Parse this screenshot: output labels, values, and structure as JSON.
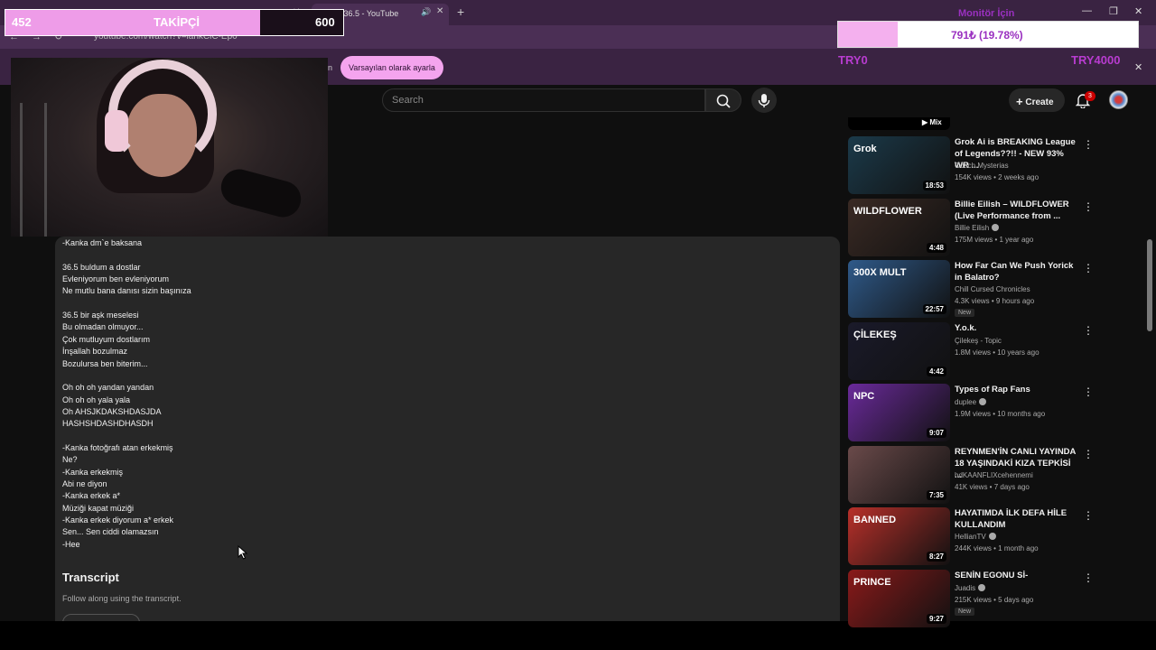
{
  "browser": {
    "prev_tab_partial": "akti 15 -",
    "active_tab_title": "(3) 36.5 - YouTube",
    "url": "youtube.com/watch?v=lahkClC-Ep0",
    "infobar_partial": "n",
    "default_button": "Varsayılan olarak ayarla"
  },
  "overlay": {
    "follower": {
      "current": "452",
      "label": "TAKİPÇİ",
      "goal": "600",
      "progress": 0.753
    },
    "donation": {
      "title": "Monitör İçin",
      "amount_text": "791₺ (19.78%)",
      "min": "TRY0",
      "max": "TRY4000",
      "progress": 0.1978
    }
  },
  "youtube": {
    "search_placeholder": "Search",
    "create_label": "Create",
    "notification_count": "3"
  },
  "description": {
    "lyrics": [
      "-Kanka dm`e baksana",
      "",
      "36.5 buldum a dostlar",
      "Evleniyorum ben evleniyorum",
      "Ne mutlu bana danısı sizin başınıza",
      "",
      "36.5 bir aşk meselesi",
      "Bu olmadan olmuyor...",
      "Çok mutluyum dostlarım",
      "İnşallah bozulmaz",
      "Bozulursa ben biterim...",
      "",
      "Oh oh oh yandan yandan",
      "Oh oh oh yala yala",
      "Oh AHSJKDAKSHDASJDA",
      "HASHSHDASHDHASDH",
      "",
      "-Kanka fotoğrafı atan erkekmiş",
      "Ne?",
      "-Kanka erkekmiş",
      "Abi ne diyon",
      "-Kanka erkek a*",
      "Müziği kapat müziği",
      "-Kanka erkek diyorum a* erkek",
      "Sen... Sen ciddi olamazsın",
      "-Hee"
    ],
    "transcript_title": "Transcript",
    "transcript_subtitle": "Follow along using the transcript."
  },
  "sidebar": {
    "mix_label": "▶ Mix",
    "videos": [
      {
        "title": "Grok Ai is BREAKING League of Legends??!! - NEW 93% WR ...",
        "channel": "Coach Mysterias",
        "verified": false,
        "meta": "154K views • 2 weeks ago",
        "duration": "18:53",
        "new": "",
        "thumb_color": "#1b3a4a",
        "thumb_text": "Grok"
      },
      {
        "title": "Billie Eilish – WILDFLOWER (Live Performance from ...",
        "channel": "Billie Eilish",
        "verified": true,
        "meta": "175M views • 1 year ago",
        "duration": "4:48",
        "new": "",
        "thumb_color": "#3a2a24",
        "thumb_text": "WILDFLOWER"
      },
      {
        "title": "How Far Can We Push Yorick in Balatro?",
        "channel": "Chill Cursed Chronicles",
        "verified": false,
        "meta": "4.3K views • 9 hours ago",
        "duration": "22:57",
        "new": "New",
        "thumb_color": "#2f5a8a",
        "thumb_text": "300X MULT"
      },
      {
        "title": "Y.o.k.",
        "channel": "Çilekeş - Topic",
        "verified": false,
        "meta": "1.8M views • 10 years ago",
        "duration": "4:42",
        "new": "",
        "thumb_color": "#1a1a2a",
        "thumb_text": "ÇİLEKEŞ"
      },
      {
        "title": "Types of Rap Fans",
        "channel": "duplee",
        "verified": true,
        "meta": "1.9M views • 10 months ago",
        "duration": "9:07",
        "new": "",
        "thumb_color": "#6a2a9a",
        "thumb_text": "NPC"
      },
      {
        "title": "REYNMEN'İN CANLI YAYINDA 18 YAŞINDAKİ KIZA TEPKİSİ ...",
        "channel": "hdKAANFLIXcehennemi",
        "verified": false,
        "meta": "41K views • 7 days ago",
        "duration": "7:35",
        "new": "",
        "thumb_color": "#6a4a4a",
        "thumb_text": ""
      },
      {
        "title": "HAYATIMDA İLK DEFA HİLE KULLANDIM",
        "channel": "HellianTV",
        "verified": true,
        "meta": "244K views • 1 month ago",
        "duration": "8:27",
        "new": "",
        "thumb_color": "#b8302a",
        "thumb_text": "BANNED"
      },
      {
        "title": "SENİN EGONU Sİ-",
        "channel": "Juadis",
        "verified": true,
        "meta": "215K views • 5 days ago",
        "duration": "9:27",
        "new": "New",
        "thumb_color": "#8a1a1a",
        "thumb_text": "PRINCE"
      }
    ]
  }
}
